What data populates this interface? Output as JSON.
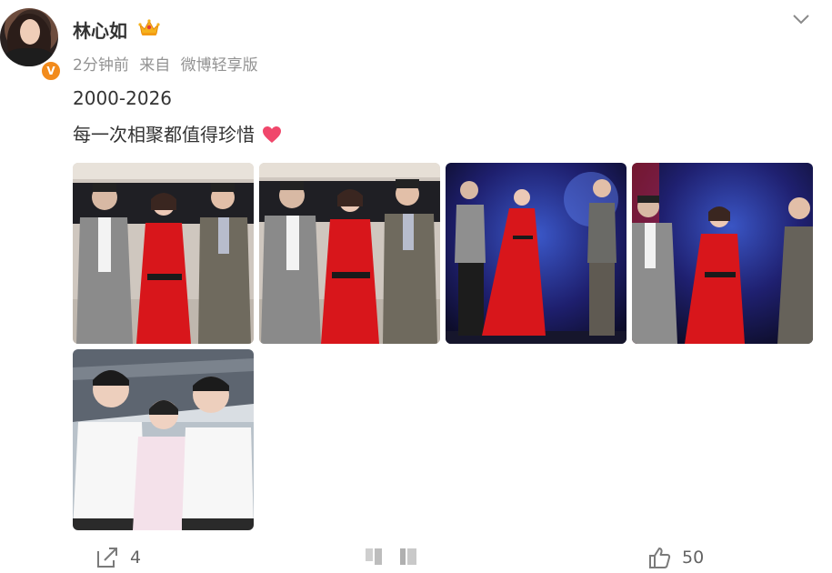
{
  "post": {
    "username": "林心如",
    "time": "2分钟前",
    "source_prefix": "来自",
    "source": "微博轻享版",
    "verify_mark": "V",
    "text_line1": "2000-2026",
    "text_line2": "每一次相聚都值得珍惜"
  },
  "icons": {
    "crown": "crown-icon",
    "heart": "heart-icon",
    "menu": "chevron-down-icon",
    "repost": "share-icon",
    "comment": "comment-icon",
    "like": "thumbs-up-icon"
  },
  "actions": {
    "repost_count": "4",
    "comment_count": "",
    "like_count": "50"
  },
  "colors": {
    "text": "#333333",
    "meta": "#939393",
    "badge": "#f28b1c",
    "heart": "#f0476b",
    "red_dress": "#d8161b"
  }
}
